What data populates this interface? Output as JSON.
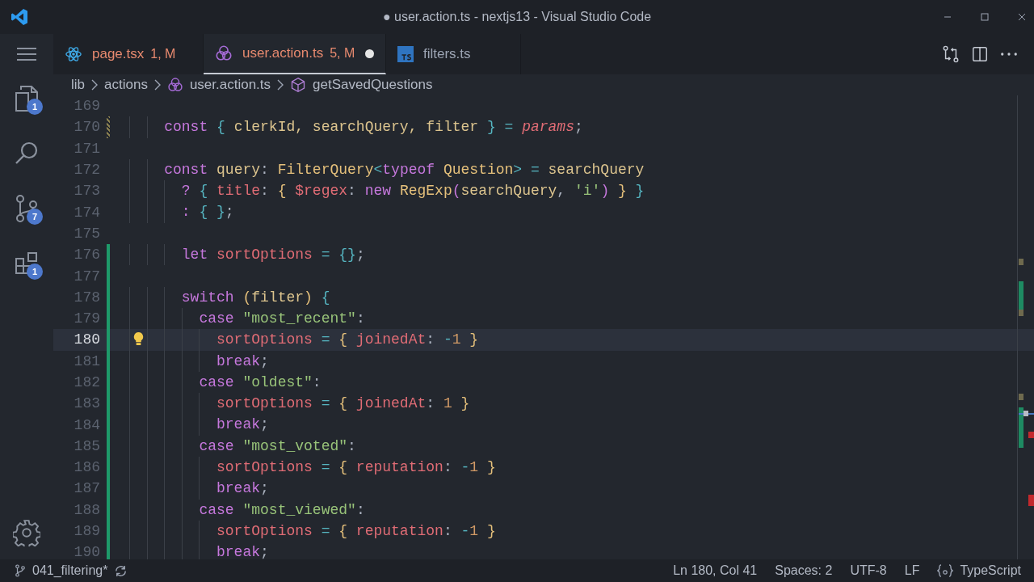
{
  "window": {
    "title": "● user.action.ts - nextjs13 - Visual Studio Code"
  },
  "activity_bar": [
    {
      "kind": "menu"
    },
    {
      "kind": "files",
      "badge": "1"
    },
    {
      "kind": "search"
    },
    {
      "kind": "source-control",
      "badge": "7"
    },
    {
      "kind": "extensions",
      "badge": "1"
    }
  ],
  "tabs": [
    {
      "kind": "react",
      "label": "page.tsx",
      "status": "1, M",
      "dirty": false,
      "selected": false
    },
    {
      "kind": "knot",
      "label": "user.action.ts",
      "status": "5, M",
      "dirty": true,
      "selected": true
    },
    {
      "kind": "ts",
      "label": "filters.ts",
      "dirty": false,
      "selected": false
    }
  ],
  "breadcrumbs": [
    {
      "label": "lib"
    },
    {
      "label": "actions"
    },
    {
      "label": "user.action.ts",
      "kind": "knot"
    },
    {
      "label": "getSavedQuestions",
      "kind": "cube"
    }
  ],
  "editor": {
    "lines": [
      {
        "number": "169",
        "current": false,
        "added": false,
        "modified": false
      },
      {
        "number": "170",
        "current": false,
        "added": false,
        "modified": true,
        "tokens": [
          {
            "t": "    const ",
            "kind": "kw"
          },
          {
            "t": "{ ",
            "kind": "b1"
          },
          {
            "t": "clerkId, searchQuery, filter ",
            "kind": "ident"
          },
          {
            "t": "} ",
            "kind": "b1"
          },
          {
            "t": "= ",
            "kind": "op"
          },
          {
            "t": "params",
            "kind": "param"
          },
          {
            "t": ";",
            "kind": "punc"
          }
        ]
      },
      {
        "number": "171",
        "current": false,
        "added": false,
        "modified": false
      },
      {
        "number": "172",
        "current": false,
        "added": false,
        "modified": false,
        "tokens": [
          {
            "t": "    const ",
            "kind": "kw"
          },
          {
            "t": "query",
            "kind": "ident"
          },
          {
            "t": ": ",
            "kind": "punc"
          },
          {
            "t": "FilterQuery",
            "kind": "type"
          },
          {
            "t": "<",
            "kind": "b1"
          },
          {
            "t": "typeof ",
            "kind": "kw"
          },
          {
            "t": "Question",
            "kind": "type"
          },
          {
            "t": "> = ",
            "kind": "op"
          },
          {
            "t": "searchQuery",
            "kind": "ident"
          }
        ]
      },
      {
        "number": "173",
        "current": false,
        "added": false,
        "modified": false,
        "tokens": [
          {
            "t": "      ? ",
            "kind": "kw"
          },
          {
            "t": "{ ",
            "kind": "b1"
          },
          {
            "t": "title",
            "kind": "prop"
          },
          {
            "t": ": ",
            "kind": "punc"
          },
          {
            "t": "{ ",
            "kind": "b2"
          },
          {
            "t": "$regex",
            "kind": "prop"
          },
          {
            "t": ": ",
            "kind": "punc"
          },
          {
            "t": "new ",
            "kind": "kw"
          },
          {
            "t": "RegExp",
            "kind": "type"
          },
          {
            "t": "(",
            "kind": "b3"
          },
          {
            "t": "searchQuery",
            "kind": "ident"
          },
          {
            "t": ", ",
            "kind": "punc"
          },
          {
            "t": "'i'",
            "kind": "str"
          },
          {
            "t": ")",
            "kind": "b3"
          },
          {
            "t": " } ",
            "kind": "b2"
          },
          {
            "t": "}",
            "kind": "b1"
          }
        ]
      },
      {
        "number": "174",
        "current": false,
        "added": false,
        "modified": false,
        "tokens": [
          {
            "t": "      : ",
            "kind": "kw"
          },
          {
            "t": "{ }",
            "kind": "b1"
          },
          {
            "t": ";",
            "kind": "punc"
          }
        ]
      },
      {
        "number": "175",
        "current": false,
        "added": false,
        "modified": false
      },
      {
        "number": "176",
        "current": false,
        "added": true,
        "modified": false,
        "tokens": [
          {
            "t": "      let ",
            "kind": "kw"
          },
          {
            "t": "sortOptions ",
            "kind": "prop"
          },
          {
            "t": "= ",
            "kind": "op"
          },
          {
            "t": "{}",
            "kind": "b1"
          },
          {
            "t": ";",
            "kind": "punc"
          }
        ]
      },
      {
        "number": "177",
        "current": false,
        "added": true,
        "modified": false
      },
      {
        "number": "178",
        "current": false,
        "added": true,
        "modified": false,
        "tokens": [
          {
            "t": "      switch ",
            "kind": "kw"
          },
          {
            "t": "(",
            "kind": "b2"
          },
          {
            "t": "filter",
            "kind": "ident"
          },
          {
            "t": ") ",
            "kind": "b2"
          },
          {
            "t": "{",
            "kind": "b1"
          }
        ]
      },
      {
        "number": "179",
        "current": false,
        "added": true,
        "modified": false,
        "tokens": [
          {
            "t": "        case ",
            "kind": "kw"
          },
          {
            "t": "\"most_recent\"",
            "kind": "str"
          },
          {
            "t": ":",
            "kind": "punc"
          }
        ]
      },
      {
        "number": "180",
        "current": true,
        "added": true,
        "modified": false,
        "tokens": [
          {
            "t": "          sortOptions ",
            "kind": "prop"
          },
          {
            "t": "= ",
            "kind": "op"
          },
          {
            "t": "{",
            "kind": "b2"
          },
          {
            "t": " joinedAt",
            "kind": "prop"
          },
          {
            "t": ": ",
            "kind": "punc"
          },
          {
            "t": "-",
            "kind": "op"
          },
          {
            "t": "1",
            "kind": "num"
          },
          {
            "t": " }",
            "kind": "b2"
          }
        ]
      },
      {
        "number": "181",
        "current": false,
        "added": true,
        "modified": false,
        "tokens": [
          {
            "t": "          break",
            "kind": "kw"
          },
          {
            "t": ";",
            "kind": "punc"
          }
        ]
      },
      {
        "number": "182",
        "current": false,
        "added": true,
        "modified": false,
        "tokens": [
          {
            "t": "        case ",
            "kind": "kw"
          },
          {
            "t": "\"oldest\"",
            "kind": "str"
          },
          {
            "t": ":",
            "kind": "punc"
          }
        ]
      },
      {
        "number": "183",
        "current": false,
        "added": true,
        "modified": false,
        "tokens": [
          {
            "t": "          sortOptions ",
            "kind": "prop"
          },
          {
            "t": "= ",
            "kind": "op"
          },
          {
            "t": "{",
            "kind": "b2"
          },
          {
            "t": " joinedAt",
            "kind": "prop"
          },
          {
            "t": ": ",
            "kind": "punc"
          },
          {
            "t": "1",
            "kind": "num"
          },
          {
            "t": " }",
            "kind": "b2"
          }
        ]
      },
      {
        "number": "184",
        "current": false,
        "added": true,
        "modified": false,
        "tokens": [
          {
            "t": "          break",
            "kind": "kw"
          },
          {
            "t": ";",
            "kind": "punc"
          }
        ]
      },
      {
        "number": "185",
        "current": false,
        "added": true,
        "modified": false,
        "tokens": [
          {
            "t": "        case ",
            "kind": "kw"
          },
          {
            "t": "\"most_voted\"",
            "kind": "str"
          },
          {
            "t": ":",
            "kind": "punc"
          }
        ]
      },
      {
        "number": "186",
        "current": false,
        "added": true,
        "modified": false,
        "tokens": [
          {
            "t": "          sortOptions ",
            "kind": "prop"
          },
          {
            "t": "= ",
            "kind": "op"
          },
          {
            "t": "{",
            "kind": "b2"
          },
          {
            "t": " reputation",
            "kind": "prop"
          },
          {
            "t": ": ",
            "kind": "punc"
          },
          {
            "t": "-",
            "kind": "op"
          },
          {
            "t": "1",
            "kind": "num"
          },
          {
            "t": " }",
            "kind": "b2"
          }
        ]
      },
      {
        "number": "187",
        "current": false,
        "added": true,
        "modified": false,
        "tokens": [
          {
            "t": "          break",
            "kind": "kw"
          },
          {
            "t": ";",
            "kind": "punc"
          }
        ]
      },
      {
        "number": "188",
        "current": false,
        "added": true,
        "modified": false,
        "tokens": [
          {
            "t": "        case ",
            "kind": "kw"
          },
          {
            "t": "\"most_viewed\"",
            "kind": "str"
          },
          {
            "t": ":",
            "kind": "punc"
          }
        ]
      },
      {
        "number": "189",
        "current": false,
        "added": true,
        "modified": false,
        "tokens": [
          {
            "t": "          sortOptions ",
            "kind": "prop"
          },
          {
            "t": "= ",
            "kind": "op"
          },
          {
            "t": "{",
            "kind": "b2"
          },
          {
            "t": " reputation",
            "kind": "prop"
          },
          {
            "t": ": ",
            "kind": "punc"
          },
          {
            "t": "-",
            "kind": "op"
          },
          {
            "t": "1",
            "kind": "num"
          },
          {
            "t": " }",
            "kind": "b2"
          }
        ]
      },
      {
        "number": "190",
        "current": false,
        "added": true,
        "modified": false,
        "tokens": [
          {
            "t": "          break",
            "kind": "kw"
          },
          {
            "t": ";",
            "kind": "punc"
          }
        ]
      }
    ]
  },
  "status_bar": {
    "branch": "041_filtering*",
    "items": [
      {
        "label": "Ln 180, Col 41"
      },
      {
        "label": "Spaces: 2"
      },
      {
        "label": "UTF-8"
      },
      {
        "label": "LF"
      },
      {
        "label": "TypeScript",
        "kind": "language"
      }
    ]
  }
}
